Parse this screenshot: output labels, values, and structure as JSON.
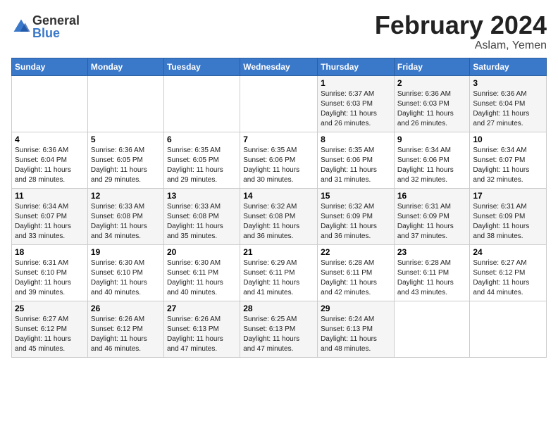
{
  "logo": {
    "general": "General",
    "blue": "Blue"
  },
  "title": {
    "month_year": "February 2024",
    "location": "Aslam, Yemen"
  },
  "days_of_week": [
    "Sunday",
    "Monday",
    "Tuesday",
    "Wednesday",
    "Thursday",
    "Friday",
    "Saturday"
  ],
  "weeks": [
    [
      {
        "day": "",
        "info": ""
      },
      {
        "day": "",
        "info": ""
      },
      {
        "day": "",
        "info": ""
      },
      {
        "day": "",
        "info": ""
      },
      {
        "day": "1",
        "info": "Sunrise: 6:37 AM\nSunset: 6:03 PM\nDaylight: 11 hours\nand 26 minutes."
      },
      {
        "day": "2",
        "info": "Sunrise: 6:36 AM\nSunset: 6:03 PM\nDaylight: 11 hours\nand 26 minutes."
      },
      {
        "day": "3",
        "info": "Sunrise: 6:36 AM\nSunset: 6:04 PM\nDaylight: 11 hours\nand 27 minutes."
      }
    ],
    [
      {
        "day": "4",
        "info": "Sunrise: 6:36 AM\nSunset: 6:04 PM\nDaylight: 11 hours\nand 28 minutes."
      },
      {
        "day": "5",
        "info": "Sunrise: 6:36 AM\nSunset: 6:05 PM\nDaylight: 11 hours\nand 29 minutes."
      },
      {
        "day": "6",
        "info": "Sunrise: 6:35 AM\nSunset: 6:05 PM\nDaylight: 11 hours\nand 29 minutes."
      },
      {
        "day": "7",
        "info": "Sunrise: 6:35 AM\nSunset: 6:06 PM\nDaylight: 11 hours\nand 30 minutes."
      },
      {
        "day": "8",
        "info": "Sunrise: 6:35 AM\nSunset: 6:06 PM\nDaylight: 11 hours\nand 31 minutes."
      },
      {
        "day": "9",
        "info": "Sunrise: 6:34 AM\nSunset: 6:06 PM\nDaylight: 11 hours\nand 32 minutes."
      },
      {
        "day": "10",
        "info": "Sunrise: 6:34 AM\nSunset: 6:07 PM\nDaylight: 11 hours\nand 32 minutes."
      }
    ],
    [
      {
        "day": "11",
        "info": "Sunrise: 6:34 AM\nSunset: 6:07 PM\nDaylight: 11 hours\nand 33 minutes."
      },
      {
        "day": "12",
        "info": "Sunrise: 6:33 AM\nSunset: 6:08 PM\nDaylight: 11 hours\nand 34 minutes."
      },
      {
        "day": "13",
        "info": "Sunrise: 6:33 AM\nSunset: 6:08 PM\nDaylight: 11 hours\nand 35 minutes."
      },
      {
        "day": "14",
        "info": "Sunrise: 6:32 AM\nSunset: 6:08 PM\nDaylight: 11 hours\nand 36 minutes."
      },
      {
        "day": "15",
        "info": "Sunrise: 6:32 AM\nSunset: 6:09 PM\nDaylight: 11 hours\nand 36 minutes."
      },
      {
        "day": "16",
        "info": "Sunrise: 6:31 AM\nSunset: 6:09 PM\nDaylight: 11 hours\nand 37 minutes."
      },
      {
        "day": "17",
        "info": "Sunrise: 6:31 AM\nSunset: 6:09 PM\nDaylight: 11 hours\nand 38 minutes."
      }
    ],
    [
      {
        "day": "18",
        "info": "Sunrise: 6:31 AM\nSunset: 6:10 PM\nDaylight: 11 hours\nand 39 minutes."
      },
      {
        "day": "19",
        "info": "Sunrise: 6:30 AM\nSunset: 6:10 PM\nDaylight: 11 hours\nand 40 minutes."
      },
      {
        "day": "20",
        "info": "Sunrise: 6:30 AM\nSunset: 6:11 PM\nDaylight: 11 hours\nand 40 minutes."
      },
      {
        "day": "21",
        "info": "Sunrise: 6:29 AM\nSunset: 6:11 PM\nDaylight: 11 hours\nand 41 minutes."
      },
      {
        "day": "22",
        "info": "Sunrise: 6:28 AM\nSunset: 6:11 PM\nDaylight: 11 hours\nand 42 minutes."
      },
      {
        "day": "23",
        "info": "Sunrise: 6:28 AM\nSunset: 6:11 PM\nDaylight: 11 hours\nand 43 minutes."
      },
      {
        "day": "24",
        "info": "Sunrise: 6:27 AM\nSunset: 6:12 PM\nDaylight: 11 hours\nand 44 minutes."
      }
    ],
    [
      {
        "day": "25",
        "info": "Sunrise: 6:27 AM\nSunset: 6:12 PM\nDaylight: 11 hours\nand 45 minutes."
      },
      {
        "day": "26",
        "info": "Sunrise: 6:26 AM\nSunset: 6:12 PM\nDaylight: 11 hours\nand 46 minutes."
      },
      {
        "day": "27",
        "info": "Sunrise: 6:26 AM\nSunset: 6:13 PM\nDaylight: 11 hours\nand 47 minutes."
      },
      {
        "day": "28",
        "info": "Sunrise: 6:25 AM\nSunset: 6:13 PM\nDaylight: 11 hours\nand 47 minutes."
      },
      {
        "day": "29",
        "info": "Sunrise: 6:24 AM\nSunset: 6:13 PM\nDaylight: 11 hours\nand 48 minutes."
      },
      {
        "day": "",
        "info": ""
      },
      {
        "day": "",
        "info": ""
      }
    ]
  ]
}
